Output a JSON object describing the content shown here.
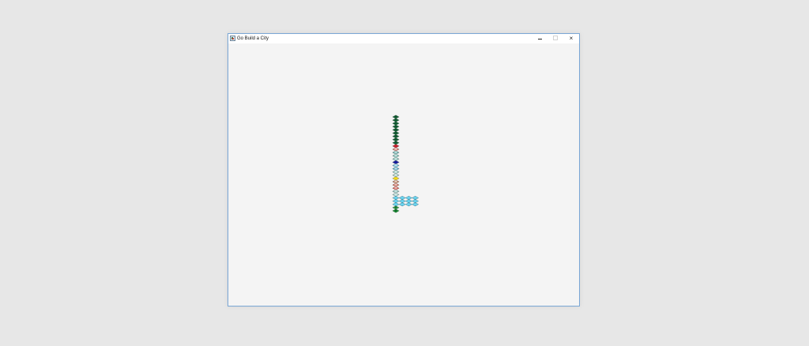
{
  "window": {
    "title": "Go Build a City",
    "controls": {
      "minimize": "minimize",
      "maximize": "maximize",
      "close": "×"
    }
  },
  "tiles": [
    {
      "row": 0,
      "col": 0,
      "kind": "tree",
      "color": "#136236"
    },
    {
      "row": 1,
      "col": 0,
      "kind": "tree",
      "color": "#136236"
    },
    {
      "row": 2,
      "col": 0,
      "kind": "tree",
      "color": "#136236"
    },
    {
      "row": 3,
      "col": 0,
      "kind": "tree",
      "color": "#136236"
    },
    {
      "row": 4,
      "col": 0,
      "kind": "tree",
      "color": "#136236"
    },
    {
      "row": 5,
      "col": 0,
      "kind": "tree",
      "color": "#136236"
    },
    {
      "row": 6,
      "col": 0,
      "kind": "tree",
      "color": "#136236"
    },
    {
      "row": 7,
      "col": 0,
      "kind": "tree",
      "color": "#136236"
    },
    {
      "row": 8,
      "col": 0,
      "kind": "tree",
      "color": "#136236"
    },
    {
      "row": 9,
      "col": 0,
      "kind": "red",
      "color": "#c8212d"
    },
    {
      "row": 10,
      "col": 0,
      "kind": "small-house",
      "color": "#d36a5e"
    },
    {
      "row": 11,
      "col": 0,
      "kind": "house",
      "color": "#59a8a4"
    },
    {
      "row": 12,
      "col": 0,
      "kind": "house",
      "color": "#6fb8ad"
    },
    {
      "row": 13,
      "col": 0,
      "kind": "house",
      "color": "#7cbdb5"
    },
    {
      "row": 14,
      "col": 0,
      "kind": "blue",
      "color": "#171d9e"
    },
    {
      "row": 15,
      "col": 0,
      "kind": "house",
      "color": "#5eb7d4"
    },
    {
      "row": 16,
      "col": 0,
      "kind": "house",
      "color": "#4aa7c4"
    },
    {
      "row": 17,
      "col": 0,
      "kind": "house",
      "color": "#8ec8bf"
    },
    {
      "row": 18,
      "col": 0,
      "kind": "house",
      "color": "#98c7bb"
    },
    {
      "row": 19,
      "col": 0,
      "kind": "yellow",
      "color": "#f3d81b"
    },
    {
      "row": 20,
      "col": 0,
      "kind": "roof",
      "color": "#b87552"
    },
    {
      "row": 21,
      "col": 0,
      "kind": "roof",
      "color": "#cc5f4d"
    },
    {
      "row": 22,
      "col": 0,
      "kind": "roof",
      "color": "#d24d43"
    },
    {
      "row": 23,
      "col": 0,
      "kind": "building",
      "color": "#85b9b3"
    },
    {
      "row": 24,
      "col": 0,
      "kind": "building",
      "color": "#9bcac3"
    },
    {
      "row": 25,
      "col": 0,
      "kind": "water",
      "color": "#47c7ea"
    },
    {
      "row": 25,
      "col": 1,
      "kind": "water",
      "color": "#47c7ea"
    },
    {
      "row": 25,
      "col": 2,
      "kind": "water",
      "color": "#47c7ea"
    },
    {
      "row": 25,
      "col": 3,
      "kind": "water",
      "color": "#47c7ea"
    },
    {
      "row": 26,
      "col": 0,
      "kind": "water",
      "color": "#47c7ea"
    },
    {
      "row": 26,
      "col": 1,
      "kind": "water",
      "color": "#47c7ea"
    },
    {
      "row": 26,
      "col": 2,
      "kind": "water",
      "color": "#47c7ea"
    },
    {
      "row": 26,
      "col": 3,
      "kind": "water",
      "color": "#47c7ea"
    },
    {
      "row": 27,
      "col": 0,
      "kind": "water",
      "color": "#47c7ea"
    },
    {
      "row": 27,
      "col": 1,
      "kind": "water",
      "color": "#47c7ea"
    },
    {
      "row": 27,
      "col": 2,
      "kind": "water",
      "color": "#47c7ea"
    },
    {
      "row": 27,
      "col": 3,
      "kind": "water",
      "color": "#47c7ea"
    },
    {
      "row": 28,
      "col": 0,
      "kind": "grass",
      "color": "#2b9d45"
    },
    {
      "row": 29,
      "col": 0,
      "kind": "grass",
      "color": "#179032"
    }
  ]
}
